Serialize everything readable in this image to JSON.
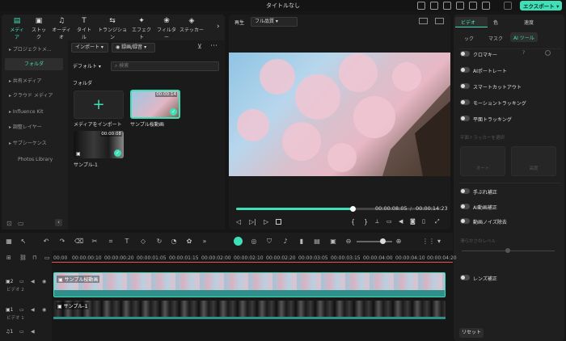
{
  "window": {
    "title": "タイトルなし",
    "export_label": "エクスポート"
  },
  "top_tabs": [
    {
      "label": "メディア",
      "icon": "media-icon",
      "active": true
    },
    {
      "label": "ストック",
      "icon": "stock-icon"
    },
    {
      "label": "オーディオ",
      "icon": "audio-icon"
    },
    {
      "label": "タイトル",
      "icon": "title-icon"
    },
    {
      "label": "トランジション",
      "icon": "transition-icon"
    },
    {
      "label": "エフェクト",
      "icon": "effect-icon"
    },
    {
      "label": "フィルター",
      "icon": "filter-icon"
    },
    {
      "label": "ステッカー",
      "icon": "sticker-icon"
    }
  ],
  "sidebar": {
    "items": [
      {
        "label": "プロジェクトメ..."
      },
      {
        "label": "フォルダ",
        "selected": true
      },
      {
        "label": "共有メディア"
      },
      {
        "label": "クラウド メディア"
      },
      {
        "label": "Influence Kit"
      },
      {
        "label": "調整レイヤー"
      },
      {
        "label": "サブシーケンス"
      },
      {
        "label": "Photos Library"
      }
    ]
  },
  "media": {
    "import_label": "インポート",
    "sort_label": "録画/録音",
    "default_label": "デフォルト",
    "search_placeholder": "検索",
    "folder_label": "フォルダ",
    "import_tile_label": "メディアをインポート",
    "items": [
      {
        "name": "サンプル桜動画",
        "duration": "00:00:14"
      },
      {
        "name": "サンプル-1",
        "duration": "00:00:08"
      }
    ]
  },
  "preview": {
    "play_label": "再生",
    "quality": "フル品質",
    "current_time": "00:00:08:05",
    "separator": "/",
    "total_time": "00:00:14:23",
    "progress": 0.57
  },
  "properties": {
    "tabs": [
      "ビデオ",
      "色",
      "速度"
    ],
    "subtabs": [
      "ック",
      "マスク",
      "AI ツール"
    ],
    "toggles_top": [
      "クロマキー",
      "AIポートレート",
      "スマートカットアウト",
      "モーショントラッキング",
      "平面トラッキング"
    ],
    "tracking_hint": "平面トラッカーを選択",
    "tracking_buttons": [
      "オート",
      "高度"
    ],
    "toggles_bottom": [
      "手ぶれ補正",
      "AI動画補正",
      "動画ノイズ除去"
    ],
    "smooth_label": "滑らかさのレベル",
    "lens_label": "レンズ補正",
    "reset_label": "リセット",
    "colors": {
      "accent": "#3fe0b7"
    }
  },
  "timeline": {
    "ruler": [
      "00:00",
      "00:00:00:10",
      "00:00:00:20",
      "00:00:01:05",
      "00:00:01:15",
      "00:00:02:00",
      "00:00:02:10",
      "00:00:02:20",
      "00:00:03:05",
      "00:00:03:15",
      "00:00:04:00",
      "00:00:04:10",
      "00:00:04:20"
    ],
    "tracks": [
      {
        "num": "2",
        "name": "ビデオ 2",
        "clip": "サンプル桜動画"
      },
      {
        "num": "1",
        "name": "ビデオ 1",
        "clip": "サンプル-1"
      },
      {
        "num": "1",
        "name": ""
      }
    ]
  }
}
